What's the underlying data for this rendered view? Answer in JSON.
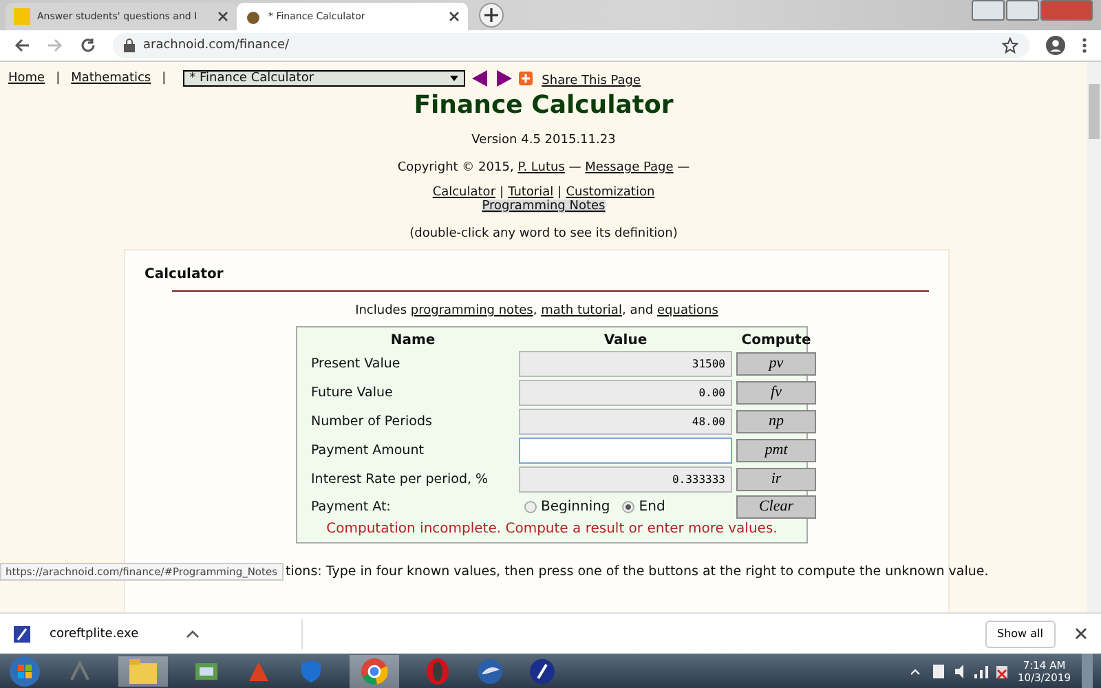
{
  "tabs": [
    {
      "title": "Answer students' questions and I",
      "selected": false
    },
    {
      "title": "* Finance Calculator",
      "selected": true
    }
  ],
  "address": "arachnoid.com/finance/",
  "nav": {
    "links": [
      "Home",
      "Mathematics"
    ],
    "separator": "|",
    "select": "* Finance Calculator",
    "share": "Share This Page"
  },
  "title": "Finance Calculator",
  "version": "Version 4.5 2015.11.23",
  "copyright": {
    "prefix": "Copyright © 2015,",
    "author": "P. Lutus",
    "message": "Message Page",
    "dash": "—"
  },
  "links": [
    "Calculator",
    "Tutorial",
    "Customization"
  ],
  "links_separator": "|",
  "programming_notes": "Programming Notes",
  "hint": "(double-click any word to see its definition)",
  "calculator": {
    "heading": "Calculator",
    "includes": {
      "prefix": "Includes",
      "links": [
        "programming notes",
        "math tutorial",
        "equations"
      ],
      "joiner": "and",
      "comma": ","
    },
    "columns": [
      "Name",
      "Value",
      "Compute"
    ],
    "rows": [
      {
        "name": "Present Value",
        "value": "31500",
        "button": "pv",
        "focused": false
      },
      {
        "name": "Future Value",
        "value": "0.00",
        "button": "fv",
        "focused": false
      },
      {
        "name": "Number of Periods",
        "value": "48.00",
        "button": "np",
        "focused": false
      },
      {
        "name": "Payment Amount",
        "button": "pmt",
        "focused": true
      },
      {
        "name": "Interest Rate per period, %",
        "value": "0.333333",
        "button": "ir",
        "focused": false
      }
    ],
    "payment_at": {
      "label": "Payment At:",
      "options": [
        {
          "label": "Beginning",
          "selected": false
        },
        {
          "label": "End",
          "selected": true
        }
      ]
    },
    "clear": "Clear",
    "message": "Computation incomplete. Compute a result or enter more values.",
    "instructions": "tions: Type in four known values, then press one of the buttons at the right to compute the unknown value."
  },
  "status_url": "https://arachnoid.com/finance/#Programming_Notes",
  "download": {
    "file": "coreftplite.exe",
    "show_all": "Show all"
  },
  "clock": {
    "time": "7:14 AM",
    "date": "10/3/2019"
  }
}
